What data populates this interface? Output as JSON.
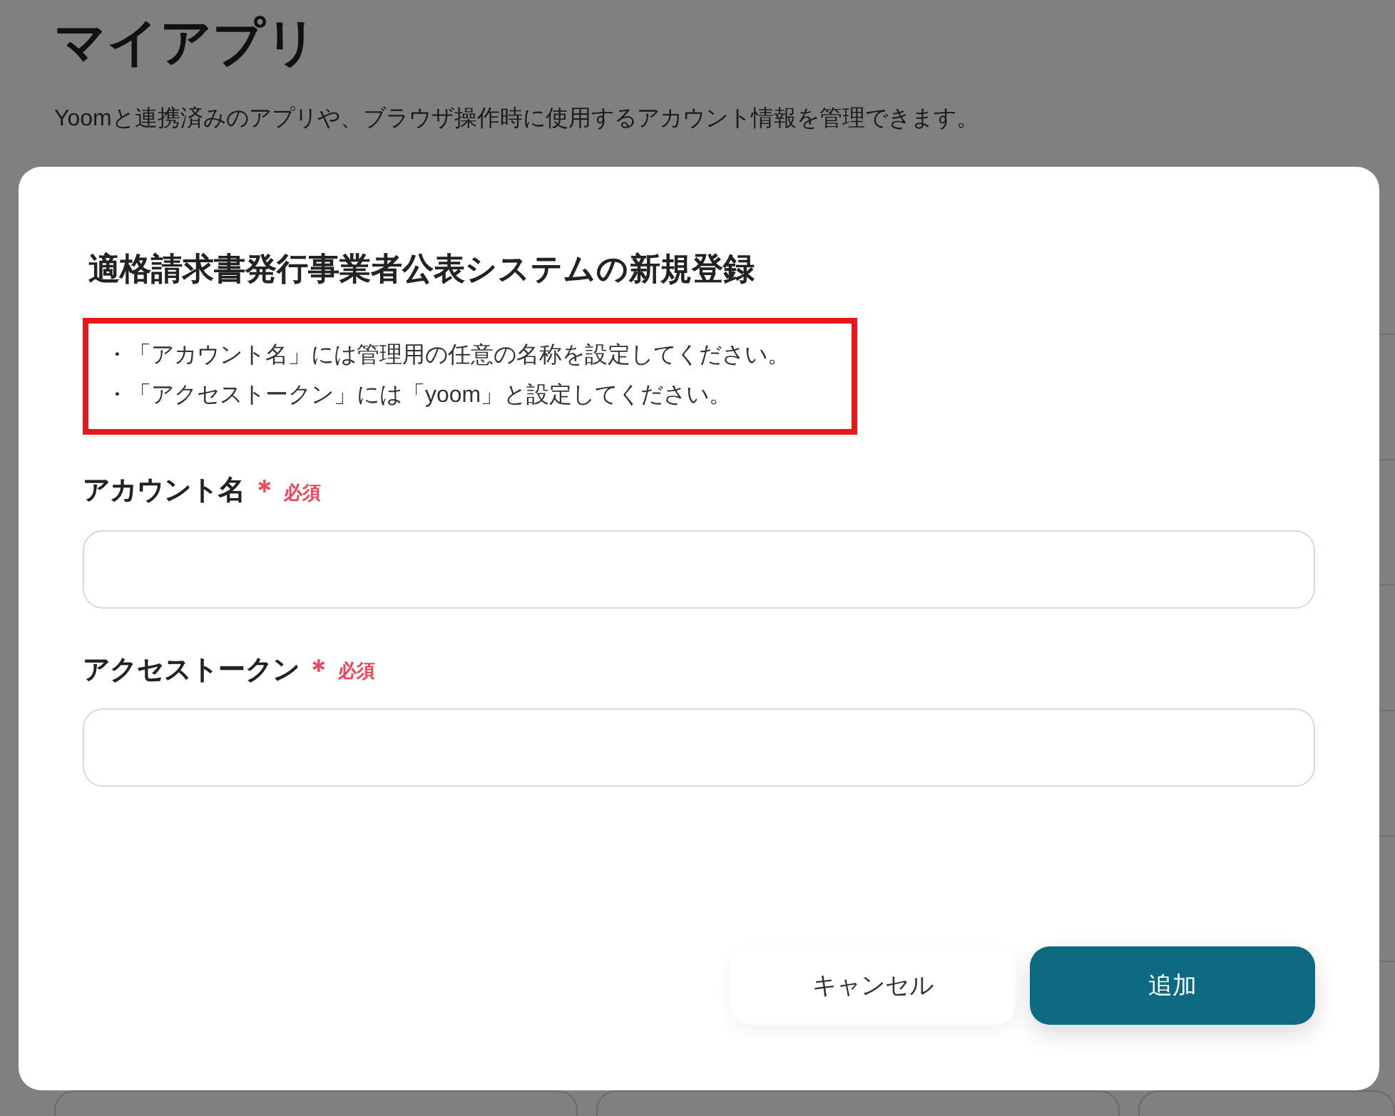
{
  "page": {
    "title": "マイアプリ",
    "description": "Yoomと連携済みのアプリや、ブラウザ操作時に使用するアカウント情報を管理できます。"
  },
  "dialog": {
    "title": "適格請求書発行事業者公表システムの新規登録",
    "notes": [
      "・「アカウント名」には管理用の任意の名称を設定してください。",
      "・「アクセストークン」には「yoom」と設定してください。"
    ],
    "fields": [
      {
        "label": "アカウント名",
        "required_mark": "＊",
        "required_label": "必須"
      },
      {
        "label": "アクセストークン",
        "required_mark": "＊",
        "required_label": "必須"
      }
    ],
    "buttons": [
      {
        "label": "キャンセル",
        "kind": "secondary"
      },
      {
        "label": "追加",
        "kind": "primary"
      }
    ]
  }
}
